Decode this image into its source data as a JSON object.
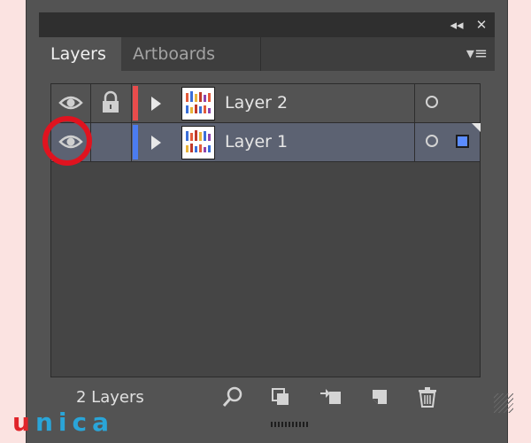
{
  "panel": {
    "collapse_icon": "◂◂",
    "close_icon": "✕",
    "tabs": [
      {
        "label": "Layers",
        "active": true
      },
      {
        "label": "Artboards",
        "active": false
      }
    ],
    "menu_icon": "▾≡"
  },
  "layers": [
    {
      "name": "Layer 2",
      "color": "#e84c4c",
      "visible": true,
      "locked": true,
      "selected": false
    },
    {
      "name": "Layer 1",
      "color": "#4b7cf0",
      "visible": true,
      "locked": false,
      "selected": true
    }
  ],
  "footer": {
    "count_label": "2 Layers"
  },
  "watermark": {
    "letters": [
      "u",
      "n",
      "i",
      "c",
      "a"
    ]
  },
  "colors": {
    "accent_highlight": "#e0131f",
    "selection_square": "#5b8cff"
  }
}
